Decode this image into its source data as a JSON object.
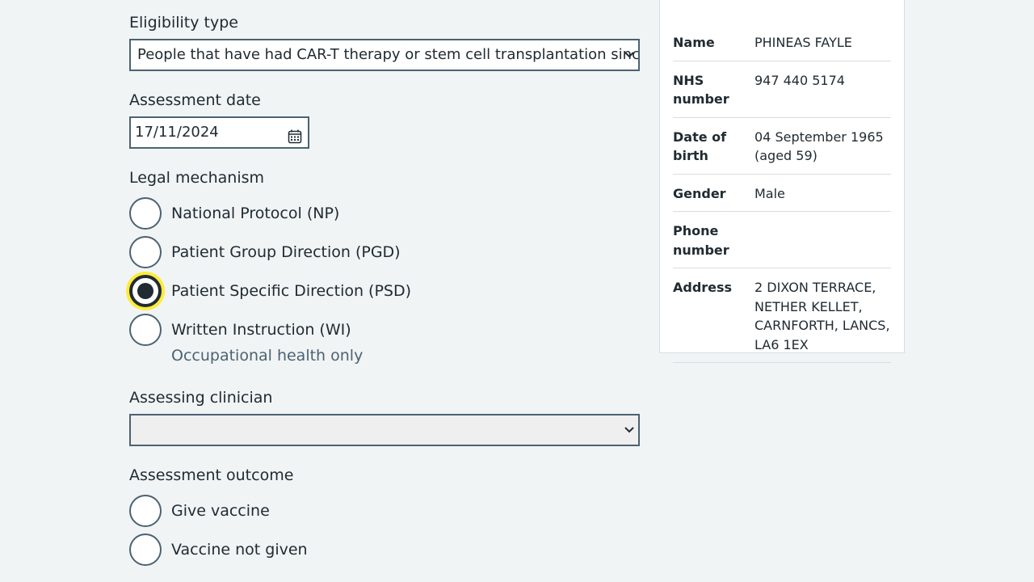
{
  "form": {
    "eligibility": {
      "label": "Eligibility type",
      "selected": "People that have had CAR-T therapy or stem cell transplantation since their last vaccination"
    },
    "assessment_date": {
      "label": "Assessment date",
      "value": "17/11/2024"
    },
    "legal_mechanism": {
      "label": "Legal mechanism",
      "options": [
        {
          "label": "National Protocol (NP)",
          "checked": false
        },
        {
          "label": "Patient Group Direction (PGD)",
          "checked": false
        },
        {
          "label": "Patient Specific Direction (PSD)",
          "checked": true
        },
        {
          "label": "Written Instruction (WI)",
          "checked": false,
          "hint": "Occupational health only"
        }
      ]
    },
    "assessing_clinician": {
      "label": "Assessing clinician",
      "selected": ""
    },
    "assessment_outcome": {
      "label": "Assessment outcome",
      "options": [
        {
          "label": "Give vaccine",
          "checked": false
        },
        {
          "label": "Vaccine not given",
          "checked": false
        }
      ]
    }
  },
  "patient": {
    "rows": [
      {
        "key": "Name",
        "value": "PHINEAS FAYLE"
      },
      {
        "key": "NHS number",
        "value": "947 440 5174"
      },
      {
        "key": "Date of birth",
        "value": "04 September 1965 (aged 59)"
      },
      {
        "key": "Gender",
        "value": "Male"
      },
      {
        "key": "Phone number",
        "value": ""
      },
      {
        "key": "Address",
        "value": "2 DIXON TERRACE, NETHER KELLET, CARNFORTH, LANCS, LA6 1EX"
      }
    ]
  },
  "icons": {
    "select_chevron": "chevron-down-icon",
    "date_picker": "calendar-icon"
  },
  "colors": {
    "background": "#f0f4f5",
    "text": "#212b32",
    "border": "#4c6272",
    "focus": "#ffeb3b",
    "hint": "#4c6272"
  }
}
